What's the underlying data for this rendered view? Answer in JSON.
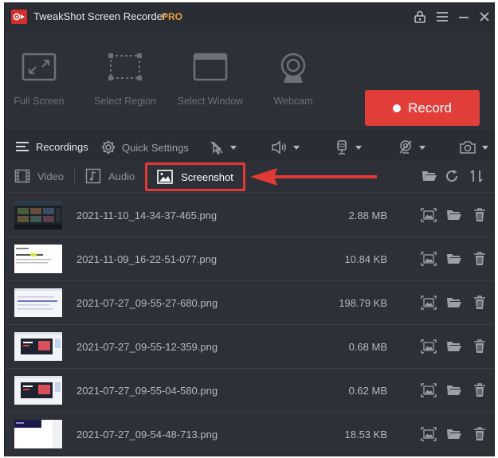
{
  "window": {
    "title": "TweakShot Screen Recorder",
    "badge": "PRO",
    "controls": [
      "lock-icon",
      "menu-icon",
      "minimize-icon",
      "close-icon"
    ]
  },
  "modes": [
    {
      "label": "Full Screen",
      "icon": "full-screen-icon"
    },
    {
      "label": "Select Region",
      "icon": "select-region-icon"
    },
    {
      "label": "Select Window",
      "icon": "select-window-icon"
    },
    {
      "label": "Webcam",
      "icon": "webcam-icon"
    }
  ],
  "record_button": {
    "label": "Record",
    "color": "#e13e3a"
  },
  "settings_bar": {
    "recordings_label": "Recordings",
    "quick_settings_label": "Quick Settings",
    "dropdowns": [
      "cursor-effects-icon",
      "speaker-icon",
      "microphone-icon",
      "webcam-off-icon",
      "camera-icon"
    ]
  },
  "tabs": {
    "video_label": "Video",
    "audio_label": "Audio",
    "screenshot_label": "Screenshot",
    "highlight_color": "#e13a35"
  },
  "toolbar_icons": [
    "folder-icon",
    "refresh-icon",
    "sort-icon"
  ],
  "files": [
    {
      "name": "2021-11-10_14-34-37-465.png",
      "size": "2.88 MB"
    },
    {
      "name": "2021-11-09_16-22-51-077.png",
      "size": "10.84 KB"
    },
    {
      "name": "2021-07-27_09-55-27-680.png",
      "size": "198.79 KB"
    },
    {
      "name": "2021-07-27_09-55-12-359.png",
      "size": "0.68 MB"
    },
    {
      "name": "2021-07-27_09-55-04-580.png",
      "size": "0.62 MB"
    },
    {
      "name": "2021-07-27_09-54-48-713.png",
      "size": "18.53 KB"
    }
  ],
  "row_actions": [
    "view-image-icon",
    "open-folder-icon",
    "delete-icon"
  ]
}
